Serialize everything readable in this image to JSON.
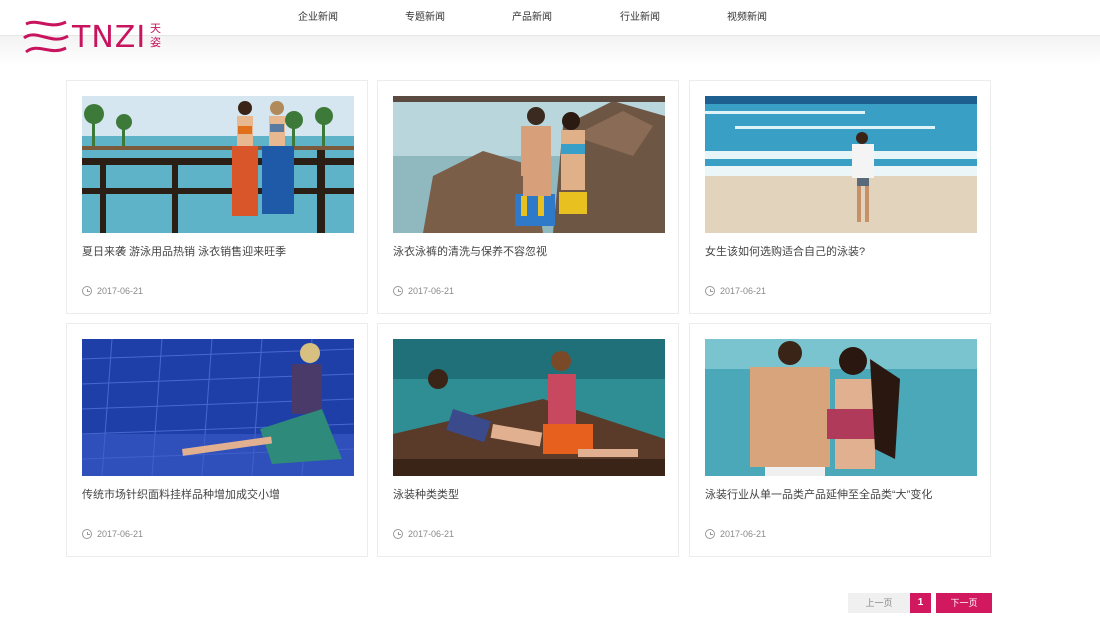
{
  "brand": {
    "logo_text": "TNZI",
    "logo_cn": "天姿",
    "accent_color": "#d2185f"
  },
  "nav": {
    "items": [
      {
        "label": "企业新闻"
      },
      {
        "label": "专题新闻"
      },
      {
        "label": "产品新闻"
      },
      {
        "label": "行业新闻"
      },
      {
        "label": "视频新闻"
      }
    ]
  },
  "articles": [
    {
      "title": "夏日来袭 游泳用品热销 泳衣销售迎来旺季",
      "date": "2017-06-21",
      "image": "two-women-swimsuits-boardwalk"
    },
    {
      "title": "泳衣泳裤的清洗与保养不容忽视",
      "date": "2017-06-21",
      "image": "couple-beach-rocks"
    },
    {
      "title": "女生该如何选购适合自己的泳装?",
      "date": "2017-06-21",
      "image": "woman-walking-beach"
    },
    {
      "title": "传统市场针织面料挂样品种增加成交小增",
      "date": "2017-06-21",
      "image": "woman-poolside-blue-tiles"
    },
    {
      "title": "泳装种类类型",
      "date": "2017-06-21",
      "image": "women-lounger-pool"
    },
    {
      "title": "泳装行业从单一品类产品延伸至全品类“大”变化",
      "date": "2017-06-21",
      "image": "couple-beach-embrace"
    }
  ],
  "pagination": {
    "prev_label": "上一页",
    "current_page": "1",
    "next_label": "下一页"
  }
}
